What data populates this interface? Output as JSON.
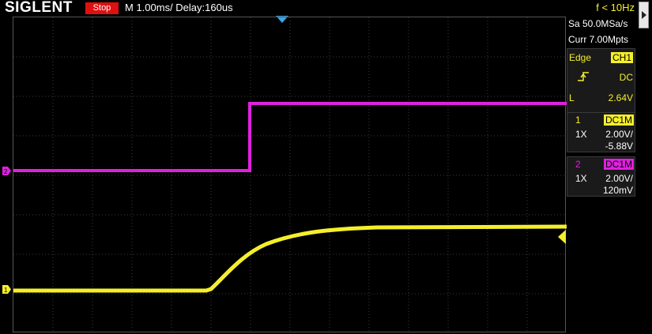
{
  "topbar": {
    "brand": "SIGLENT",
    "run_state": "Stop",
    "timebase": "M 1.00ms/ Delay:160us",
    "frequency": "f < 10Hz"
  },
  "acquisition": {
    "sample_rate": "Sa 50.0MSa/s",
    "memory_depth": "Curr 7.00Mpts"
  },
  "trigger": {
    "type": "Edge",
    "source": "CH1",
    "coupling": "DC",
    "level_label": "L",
    "level": "2.64V"
  },
  "channels": [
    {
      "number": "1",
      "coupling": "DC1M",
      "probe": "1X",
      "scale": "2.00V/",
      "offset": "-5.88V",
      "color": "#f5ef2a"
    },
    {
      "number": "2",
      "coupling": "DC1M",
      "probe": "1X",
      "scale": "2.00V/",
      "offset": "120mV",
      "color": "#e020e0"
    }
  ],
  "colors": {
    "ch1": "#f5ef2a",
    "ch2": "#e020e0",
    "run_stop": "#e01010",
    "grid": "#3c3c3c",
    "trigger_time_marker": "#3aa6e8"
  }
}
